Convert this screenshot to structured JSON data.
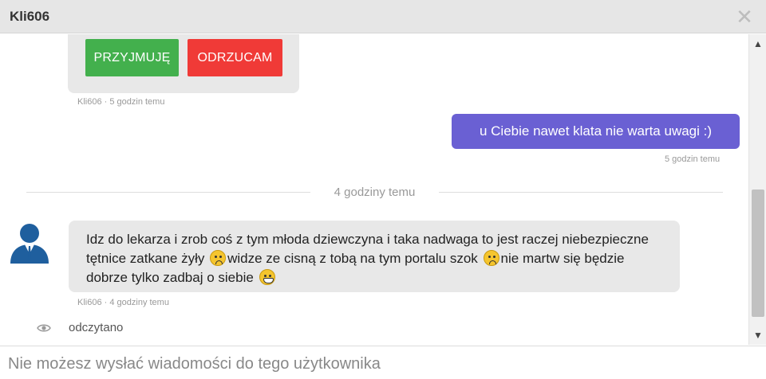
{
  "window": {
    "title": "Kli606",
    "close_icon": "close-icon"
  },
  "invite": {
    "accept_label": "PRZYJMUJĘ",
    "reject_label": "ODRZUCAM",
    "meta": "Kli606 · 5 godzin temu",
    "colors": {
      "accept": "#43b04d",
      "reject": "#f03a37"
    }
  },
  "outgoing": {
    "text": "u Ciebie nawet klata nie warta uwagi :)",
    "meta": "5 godzin temu",
    "color": "#6a60d3"
  },
  "divider": {
    "text": "4 godziny temu"
  },
  "incoming": {
    "avatar_icon": "user-avatar-icon",
    "part1": "Idz do lekarza i zrob coś z tym młoda dziewczyna i taka nadwaga to jest raczej niebezpieczne tętnice zatkane żyły",
    "emoji1": "frown-emoji-icon",
    "part2": "widze ze cisną z tobą na tym portalu szok",
    "emoji2": "frown-emoji-icon",
    "part3": "nie martw się będzie dobrze tylko zadbaj o siebie",
    "emoji3": "grin-emoji-icon",
    "meta": "Kli606 · 4 godziny temu"
  },
  "read_status": {
    "text": "odczytano",
    "icon": "eye-icon"
  },
  "composer": {
    "text": "Nie możesz wysłać wiadomości do tego użytkownika"
  }
}
